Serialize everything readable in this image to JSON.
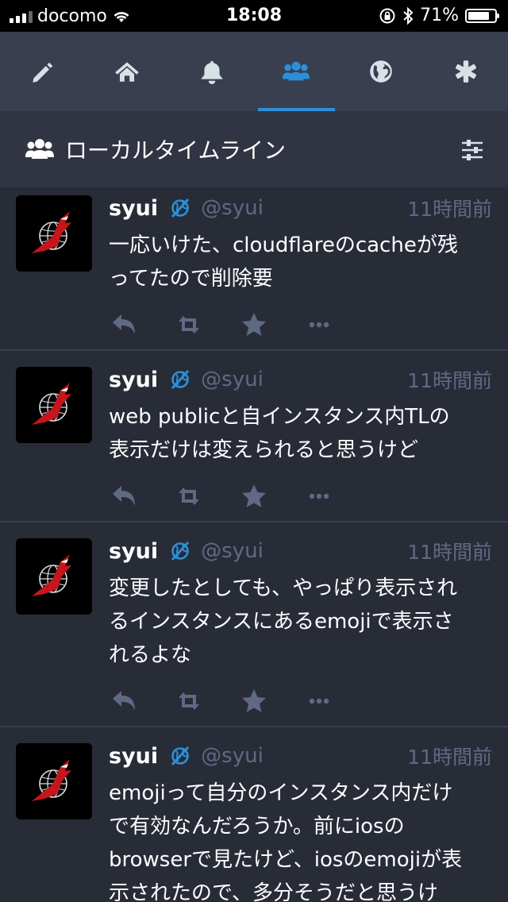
{
  "statusbar": {
    "carrier": "docomo",
    "time": "18:08",
    "battery": "71%"
  },
  "nav": {
    "tabs": [
      {
        "icon": "pencil-icon",
        "active": false
      },
      {
        "icon": "home-icon",
        "active": false
      },
      {
        "icon": "bell-icon",
        "active": false
      },
      {
        "icon": "users-icon",
        "active": true
      },
      {
        "icon": "globe-icon",
        "active": false
      },
      {
        "icon": "asterisk-icon",
        "active": false
      }
    ]
  },
  "column": {
    "title": "ローカルタイムライン"
  },
  "posts": [
    {
      "name": "syui",
      "handle": "@syui",
      "time": "11時間前",
      "text": "一応いけた、cloudflareのcacheが残\nってたので削除要"
    },
    {
      "name": "syui",
      "handle": "@syui",
      "time": "11時間前",
      "text": "web publicと自インスタンス内TLの\n表示だけは変えられると思うけど"
    },
    {
      "name": "syui",
      "handle": "@syui",
      "time": "11時間前",
      "text": "変更したとしても、やっぱり表示され\nるインスタンスにあるemojiで表示さ\nれるよな"
    },
    {
      "name": "syui",
      "handle": "@syui",
      "time": "11時間前",
      "text": "emojiって自分のインスタンス内だけ\nで有効なんだろうか。前にiosの\nbrowserで見たけど、iosのemojiが表\n示されたので、多分そうだと思うけ"
    }
  ]
}
